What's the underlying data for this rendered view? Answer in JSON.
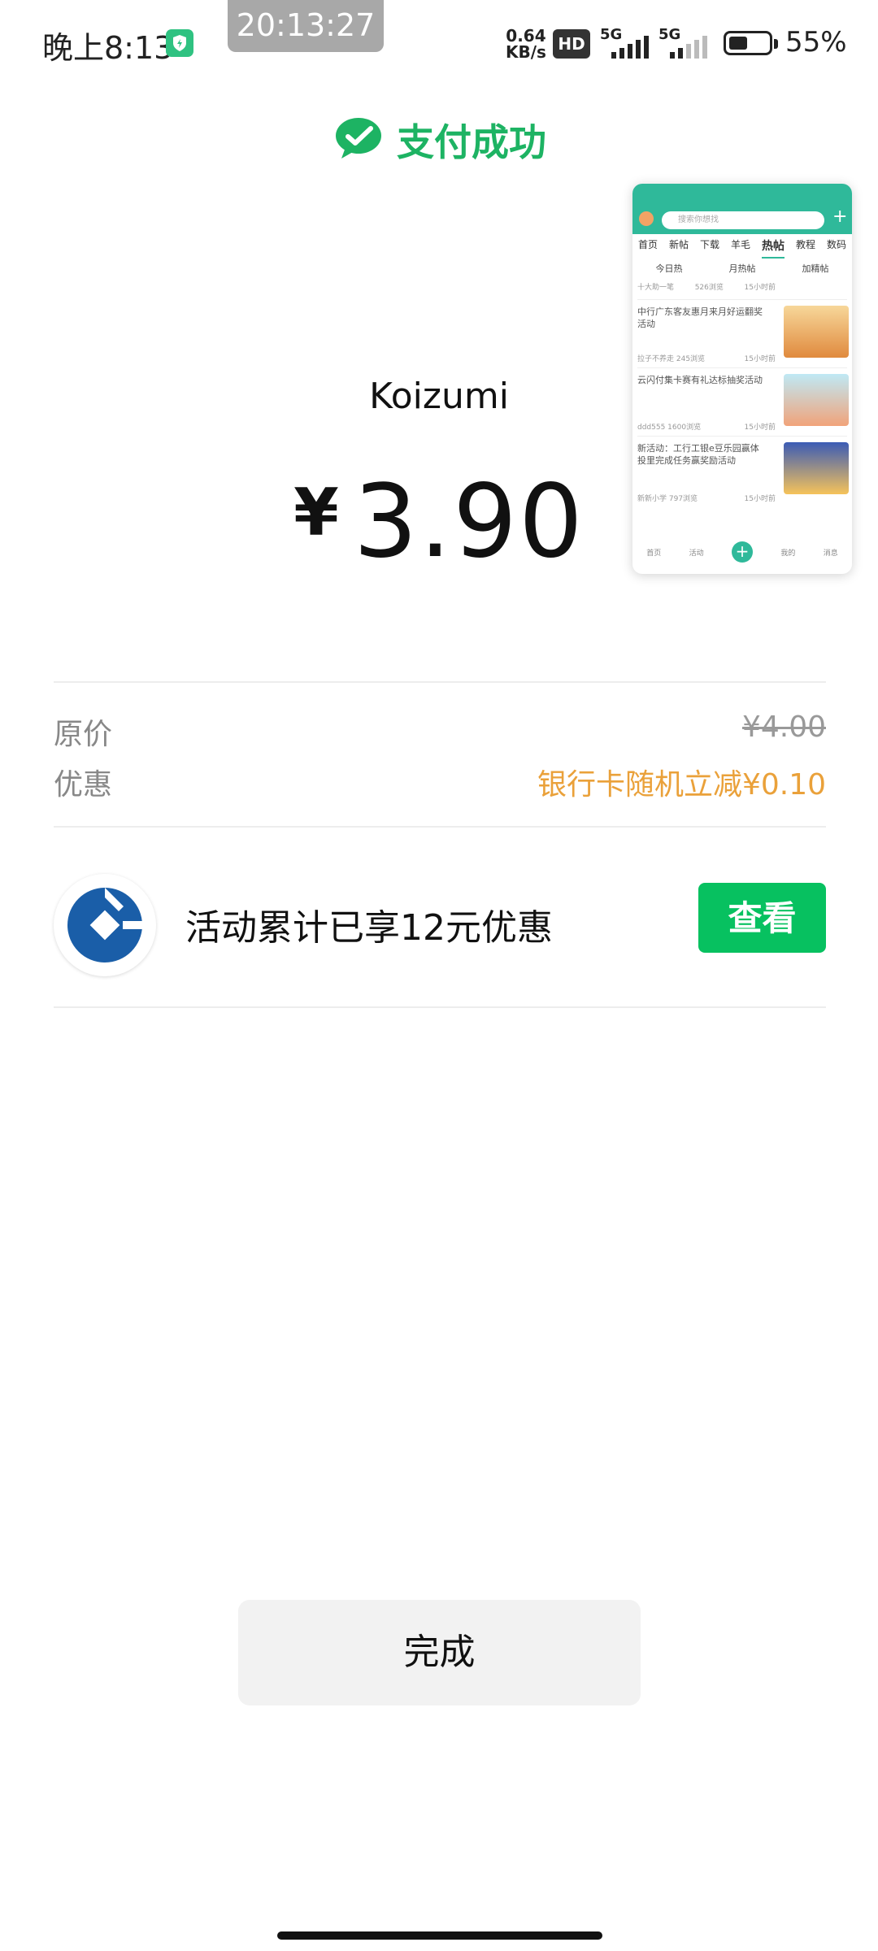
{
  "status_bar": {
    "time": "晚上8:13",
    "screen_record_time": "20:13:27",
    "net_speed_value": "0.64",
    "net_speed_unit": "KB/s",
    "hd_badge": "HD",
    "signal1_label": "5G",
    "signal2_label": "5G",
    "battery_percent": "55%"
  },
  "header": {
    "title": "支付成功",
    "icon": "wechat-pay-icon",
    "accent_color": "#1db363"
  },
  "payment": {
    "merchant": "Koizumi",
    "currency_symbol": "¥",
    "amount": "3.90"
  },
  "details": {
    "original_price_label": "原价",
    "original_price_value": "¥4.00",
    "discount_label": "优惠",
    "discount_value": "银行卡随机立减¥0.10",
    "discount_color": "#eaa13a"
  },
  "promo": {
    "bank_icon": "ccb-bank-logo-icon",
    "text": "活动累计已享12元优惠",
    "button_label": "查看",
    "button_color": "#07c160"
  },
  "thumbnail": {
    "search_placeholder": "搜索你想找",
    "tabs": [
      "首页",
      "新帖",
      "下载",
      "羊毛",
      "热帖",
      "教程",
      "数码"
    ],
    "active_tab": "热帖",
    "subtabs": [
      "今日热",
      "月热帖",
      "加精帖"
    ],
    "rows": [
      {
        "title": "十大助一笔",
        "user": "526浏览",
        "time": "15小时前"
      },
      {
        "title": "中行广东客友惠月来月好运翻奖活动",
        "user": "拉子不养走  245浏览",
        "time": "15小时前"
      },
      {
        "title": "云闪付集卡赛有礼达标抽奖活动",
        "user": "ddd555  1600浏览",
        "time": "15小时前"
      },
      {
        "title": "新活动：工行工银e豆乐园赢体投里完成任务赢奖励活动",
        "user": "新新小学  797浏览",
        "time": "15小时前"
      }
    ],
    "nav": [
      "首页",
      "活动",
      "",
      "我的",
      "消息"
    ]
  },
  "footer": {
    "done_label": "完成"
  }
}
